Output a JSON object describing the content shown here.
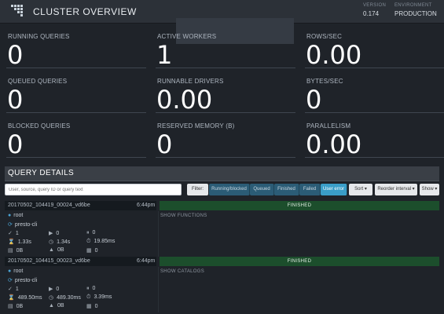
{
  "header": {
    "title": "CLUSTER OVERVIEW",
    "version_label": "VERSION",
    "version": "0.174",
    "environment_label": "ENVIRONMENT",
    "environment": "PRODUCTION"
  },
  "tiles": [
    {
      "label": "RUNNING QUERIES",
      "value": "0"
    },
    {
      "label": "ACTIVE WORKERS",
      "value": "1"
    },
    {
      "label": "ROWS/SEC",
      "value": "0.00"
    },
    {
      "label": "QUEUED QUERIES",
      "value": "0"
    },
    {
      "label": "RUNNABLE DRIVERS",
      "value": "0.00"
    },
    {
      "label": "BYTES/SEC",
      "value": "0"
    },
    {
      "label": "BLOCKED QUERIES",
      "value": "0"
    },
    {
      "label": "RESERVED MEMORY (B)",
      "value": "0"
    },
    {
      "label": "PARALLELISM",
      "value": "0.00"
    }
  ],
  "query_details": {
    "title": "QUERY DETAILS",
    "search_placeholder": "User, source, query ID or query text",
    "filter_label": "Filter:",
    "filters": [
      {
        "label": "Running/blocked",
        "active": false
      },
      {
        "label": "Queued",
        "active": false
      },
      {
        "label": "Finished",
        "active": false
      },
      {
        "label": "Failed",
        "active": false
      },
      {
        "label": "User error",
        "active": true
      }
    ],
    "sort_label": "Sort ▾",
    "reorder_label": "Reorder interval ▾",
    "show_label": "Show ▾"
  },
  "queries": [
    {
      "id": "20170502_104419_00024_vd6be",
      "time": "6:44pm",
      "state": "FINISHED",
      "user": "root",
      "source": "presto-cli",
      "completed_splits": "1",
      "running_splits": "0",
      "queued_splits": "0",
      "wall_time": "1.33s",
      "cpu_time": "1.34s",
      "elapsed_time": "19.85ms",
      "memory": "0B",
      "peak_memory": "0B",
      "cumulative": "0",
      "sql": "SHOW FUNCTIONS"
    },
    {
      "id": "20170502_104415_00023_vd6be",
      "time": "6:44pm",
      "state": "FINISHED",
      "user": "root",
      "source": "presto-cli",
      "completed_splits": "1",
      "running_splits": "0",
      "queued_splits": "0",
      "wall_time": "489.50ms",
      "cpu_time": "489.30ms",
      "elapsed_time": "3.39ms",
      "memory": "0B",
      "peak_memory": "0B",
      "cumulative": "0",
      "sql": "SHOW CATALOGS"
    }
  ],
  "colors": {
    "background": "#1f2329",
    "finished_state": "#1c4e2c",
    "active_filter": "#3a9ec8",
    "filter": "#2b5c76"
  },
  "icons": [
    "logo-icon",
    "user-icon",
    "source-icon",
    "completed-splits-icon",
    "running-splits-icon",
    "queued-splits-icon",
    "wall-time-icon",
    "cpu-time-icon",
    "elapsed-time-icon",
    "memory-icon",
    "peak-memory-icon",
    "cumulative-icon"
  ]
}
